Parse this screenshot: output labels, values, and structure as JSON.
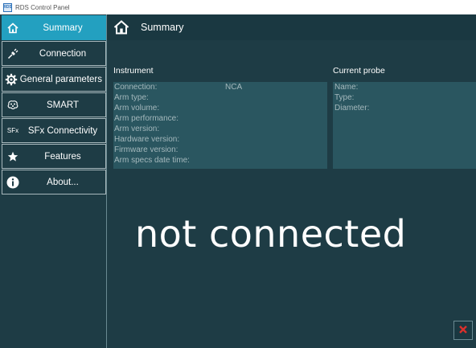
{
  "window": {
    "title": "RDS Control Panel",
    "icon_label": "RDS",
    "icon_name": "app-icon"
  },
  "sidebar": {
    "items": [
      {
        "label": "Summary",
        "icon": "home-icon",
        "active": true
      },
      {
        "label": "Connection",
        "icon": "plug-icon",
        "active": false
      },
      {
        "label": "General parameters",
        "icon": "gear-icon",
        "active": false
      },
      {
        "label": "SMART",
        "icon": "smart-icon",
        "active": false
      },
      {
        "label": "SFx Connectivity",
        "icon": "sfx-icon",
        "icon_text": "SFx",
        "active": false
      },
      {
        "label": "Features",
        "icon": "star-icon",
        "active": false
      },
      {
        "label": "About...",
        "icon": "info-icon",
        "active": false
      }
    ]
  },
  "header": {
    "title": "Summary",
    "home_icon": "home-icon"
  },
  "instrument": {
    "title": "Instrument",
    "fields": [
      {
        "label": "Connection:",
        "value": "NCA"
      },
      {
        "label": "Arm type:",
        "value": ""
      },
      {
        "label": "Arm volume:",
        "value": ""
      },
      {
        "label": "Arm performance:",
        "value": ""
      },
      {
        "label": "Arm version:",
        "value": ""
      },
      {
        "label": "Hardware version:",
        "value": ""
      },
      {
        "label": "Firmware version:",
        "value": ""
      },
      {
        "label": "Arm specs date time:",
        "value": ""
      }
    ]
  },
  "probe": {
    "title": "Current probe",
    "fields": [
      {
        "label": "Name:",
        "value": ""
      },
      {
        "label": "Type:",
        "value": ""
      },
      {
        "label": "Diameter:",
        "value": ""
      }
    ]
  },
  "status": {
    "message": "not connected"
  },
  "close_button": {
    "icon": "close-icon",
    "color": "#d9302c"
  },
  "colors": {
    "background": "#1e3c45",
    "accent": "#23a0c0",
    "panel": "#2a5660",
    "text_muted": "#a4b8bc"
  }
}
